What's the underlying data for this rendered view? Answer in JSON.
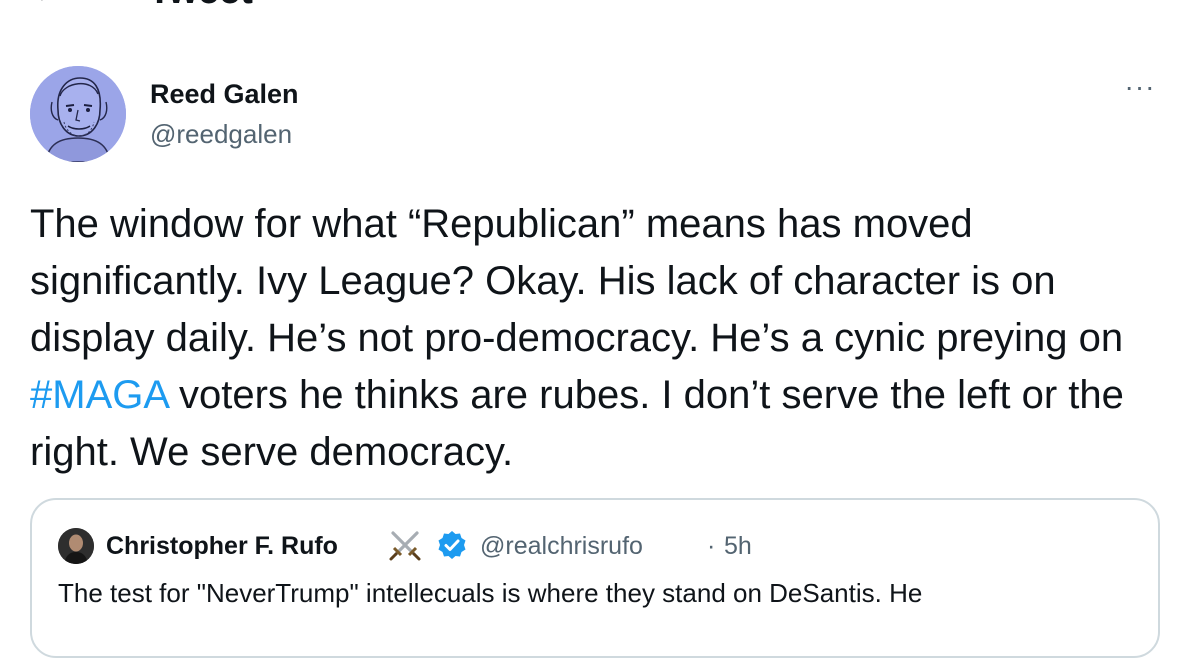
{
  "header": {
    "title": "Tweet",
    "back_icon": "arrow-left-icon"
  },
  "author": {
    "name": "Reed Galen",
    "handle": "@reedgalen",
    "more_label": "···"
  },
  "tweet": {
    "text_before": "The window for what “Republican” means has moved significantly. Ivy League? Okay. His lack of character is on display daily. He’s not pro-democracy. He’s a cynic preying on ",
    "hashtag": "#MAGA",
    "text_after": " voters he thinks are rubes. I don’t serve the left or the right.  We serve democracy."
  },
  "quote": {
    "name": "Christopher F. Rufo",
    "name_emoji_icon": "crossed-swords-icon",
    "verified_icon": "verified-badge-icon",
    "handle": "@realchrisrufo",
    "separator": "·",
    "time": "5h",
    "text": "The test for \"NeverTrump\" intellecuals is where they stand on DeSantis. He"
  },
  "colors": {
    "link": "#1d9bf0",
    "secondary": "#536471",
    "border": "#cfd9de",
    "verified": "#1d9bf0"
  }
}
